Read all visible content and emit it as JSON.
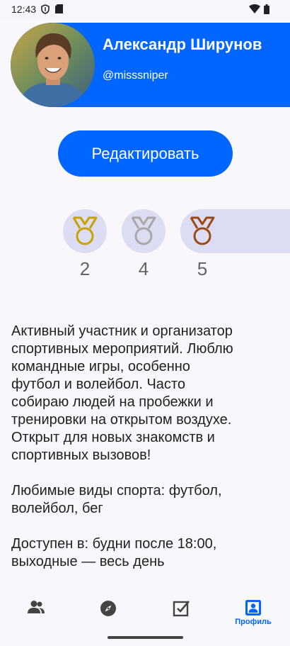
{
  "status_bar": {
    "time": "12:43",
    "icons": [
      "shield-icon",
      "sd-card-icon",
      "wifi-icon",
      "battery-icon"
    ]
  },
  "profile": {
    "name": "Александр Ширунов",
    "handle": "@misssniper",
    "edit_button_label": "Редактировать",
    "accent_color": "#0066ff"
  },
  "medals": [
    {
      "kind": "gold",
      "color": "#c8a200",
      "count": "2"
    },
    {
      "kind": "silver",
      "color": "#a8a8a8",
      "count": "4"
    },
    {
      "kind": "bronze",
      "color": "#9a4a12",
      "count": "5"
    }
  ],
  "bio": "Активный участник и организатор\nспортивных мероприятий. Люблю\nкомандные игры, особенно\nфутбол и волейбол. Часто\nсобираю людей на пробежки и\nтренировки на открытом воздухе.\nОткрыт для новых знакомств и\nспортивных вызовов!\n\nЛюбимые виды спорта: футбол,\nволейбол, бег\n\nДоступен в: будни после 18:00,\nвыходные — весь день",
  "bottom_nav": {
    "items": [
      {
        "icon": "people-icon",
        "label": ""
      },
      {
        "icon": "compass-icon",
        "label": ""
      },
      {
        "icon": "checkbox-icon",
        "label": ""
      },
      {
        "icon": "profile-icon",
        "label": "Профиль",
        "active": true
      }
    ]
  }
}
